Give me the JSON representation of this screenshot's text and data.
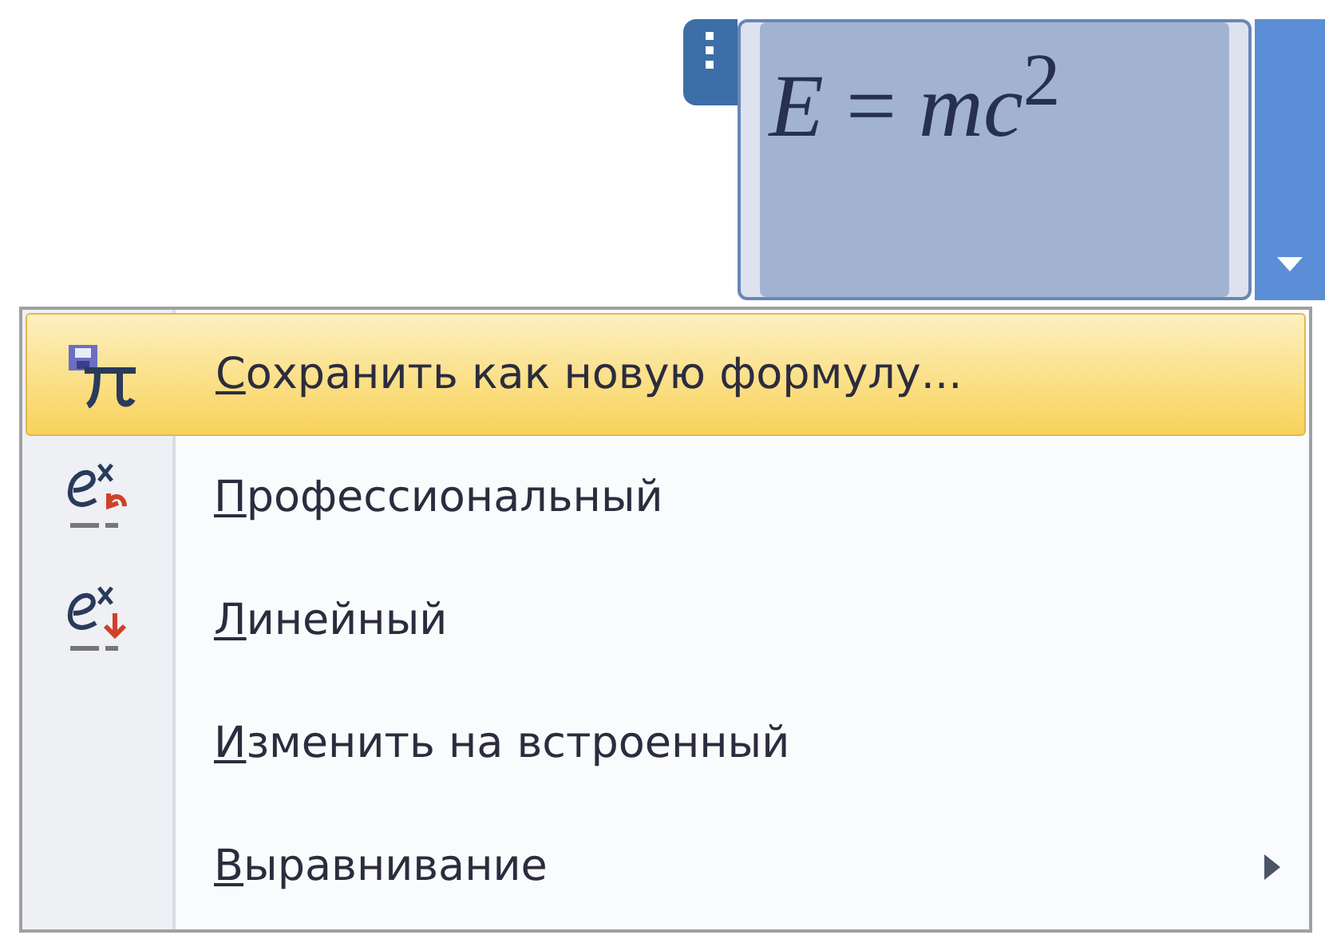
{
  "equation": {
    "formula": "*E* = *mc*$^{2}$",
    "selected": true
  },
  "menu": {
    "items": [
      {
        "label": "Сохранить как новую формулу...",
        "kind": "save",
        "selected": true,
        "mnemonic_first": true,
        "submenu": false
      },
      {
        "label": "Профессиональный",
        "kind": "professional",
        "selected": false,
        "mnemonic_first": true,
        "submenu": false
      },
      {
        "label": "Линейный",
        "kind": "linear",
        "selected": false,
        "mnemonic_first": true,
        "submenu": false
      },
      {
        "label": "Изменить на встроенный",
        "kind": "plain",
        "selected": false,
        "mnemonic_first": true,
        "submenu": false
      },
      {
        "label": "Выравнивание",
        "kind": "plain",
        "selected": false,
        "mnemonic_first": true,
        "submenu": true
      }
    ]
  }
}
